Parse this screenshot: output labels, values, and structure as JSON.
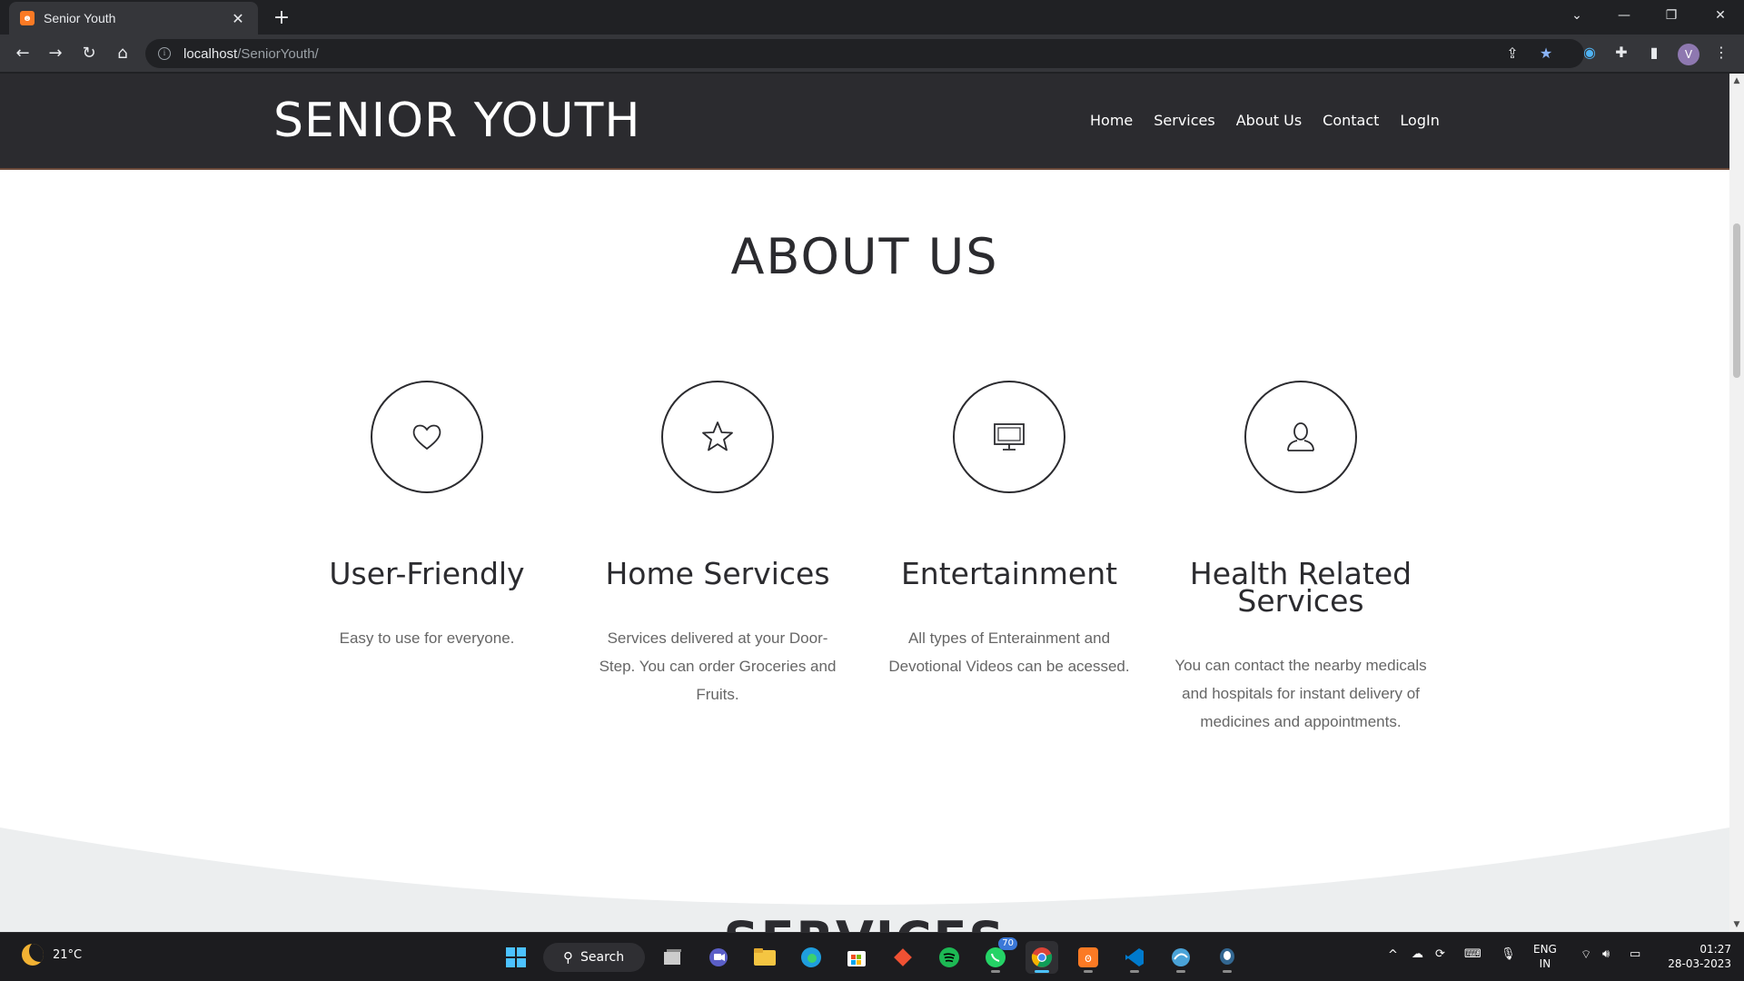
{
  "browser": {
    "tab_title": "Senior Youth",
    "tab_favicon": "xampp-icon",
    "url_host": "localhost",
    "url_path": "/SeniorYouth/",
    "profile_initial": "V"
  },
  "site": {
    "logo": "SENIOR YOUTH",
    "nav": [
      "Home",
      "Services",
      "About Us",
      "Contact",
      "LogIn"
    ]
  },
  "about": {
    "title": "ABOUT US",
    "features": [
      {
        "icon": "heart-icon",
        "heading": "User-Friendly",
        "text": "Easy to use for everyone."
      },
      {
        "icon": "star-icon",
        "heading": "Home Services",
        "text": "Services delivered at your Door-Step. You can order Groceries and Fruits."
      },
      {
        "icon": "monitor-icon",
        "heading": "Entertainment",
        "text": "All types of Enterainment and Devotional Videos can be acessed."
      },
      {
        "icon": "user-icon",
        "heading": "Health Related Services",
        "text": "You can contact the nearby medicals and hospitals for instant delivery of medicines and appointments."
      }
    ]
  },
  "next_section_title": "SERVICES",
  "taskbar": {
    "weather": "21°C",
    "search_label": "Search",
    "whatsapp_badge": "70",
    "lang_line1": "ENG",
    "lang_line2": "IN",
    "time": "01:27",
    "date": "28-03-2023"
  },
  "colors": {
    "header_bg": "#2b2b2f",
    "page_bg": "#ffffff",
    "wave_bg": "#eceeef"
  }
}
